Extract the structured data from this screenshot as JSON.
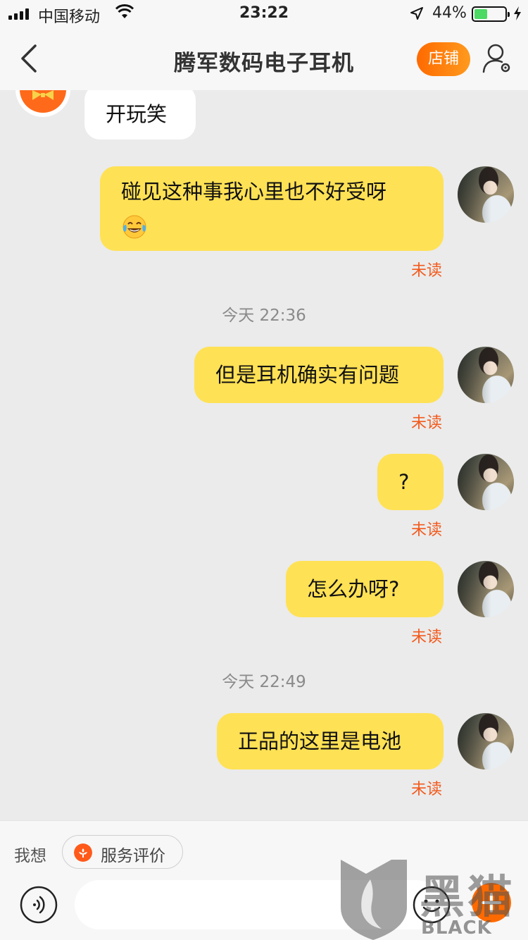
{
  "status_bar": {
    "carrier": "中国移动",
    "time": "23:22",
    "battery_percent": "44%",
    "battery_level": 0.44
  },
  "header": {
    "title": "腾军数码电子耳机",
    "shop_button": "店铺",
    "icons": {
      "back": "back-arrow-icon",
      "user": "user-settings-icon"
    }
  },
  "messages": [
    {
      "side": "left",
      "text": "开玩笑"
    },
    {
      "side": "right",
      "text": "碰见这种事我心里也不好受呀",
      "emoji": "tears-of-joy",
      "status": "未读"
    },
    {
      "type": "timestamp",
      "text": "今天 22:36"
    },
    {
      "side": "right",
      "text": "但是耳机确实有问题",
      "status": "未读"
    },
    {
      "side": "right",
      "text": "?",
      "status": "未读"
    },
    {
      "side": "right",
      "text": "怎么办呀?",
      "status": "未读"
    },
    {
      "type": "timestamp",
      "text": "今天 22:49"
    },
    {
      "side": "right",
      "text": "正品的这里是电池",
      "status": "未读"
    }
  ],
  "bottom_bar": {
    "prefix": "我想",
    "chip_label": "服务评价",
    "input_placeholder": "",
    "icons": {
      "voice": "voice-icon",
      "emoji": "emoji-icon",
      "plus": "plus-icon"
    }
  },
  "watermark": {
    "cn": "黑猫",
    "en": "BLACK CAT"
  },
  "colors": {
    "bubble_self": "#ffe155",
    "bubble_other": "#ffffff",
    "unread": "#f25a1d",
    "accent": "#ff6a00",
    "chat_bg": "#ebebeb"
  }
}
